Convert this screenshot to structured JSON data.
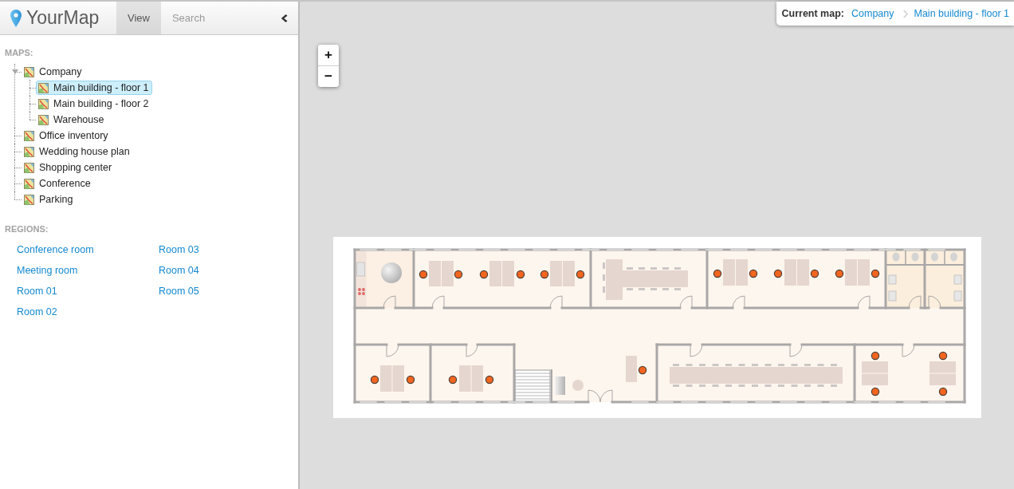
{
  "app": {
    "logo_text": "YourMap"
  },
  "tabs": [
    {
      "label": "View",
      "selected": true
    },
    {
      "label": "Search",
      "selected": false
    }
  ],
  "maps": {
    "heading": "MAPS:",
    "items": [
      {
        "label": "Company",
        "selected": false,
        "expanded": true,
        "children": [
          {
            "label": "Main building - floor 1",
            "selected": true
          },
          {
            "label": "Main building - floor 2",
            "selected": false
          },
          {
            "label": "Warehouse",
            "selected": false
          }
        ]
      },
      {
        "label": "Office inventory",
        "selected": false
      },
      {
        "label": "Wedding house plan",
        "selected": false
      },
      {
        "label": "Shopping center",
        "selected": false
      },
      {
        "label": "Conference",
        "selected": false
      },
      {
        "label": "Parking",
        "selected": false
      }
    ]
  },
  "regions": {
    "heading": "REGIONS:",
    "items": [
      "Conference room",
      "Meeting room",
      "Room 01",
      "Room 02",
      "Room 03",
      "Room 04",
      "Room 05"
    ]
  },
  "breadcrumb": {
    "label": "Current map:",
    "path": [
      "Company",
      "Main building - floor 1"
    ]
  },
  "zoom_controls": {
    "zoom_in": "+",
    "zoom_out": "−"
  }
}
